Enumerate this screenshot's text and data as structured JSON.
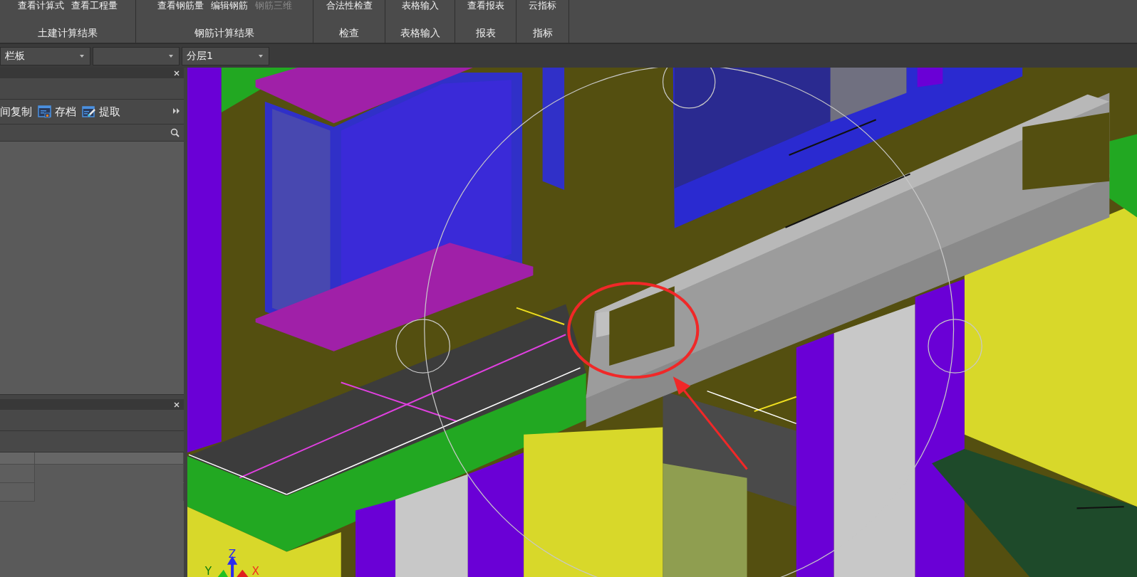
{
  "ribbon": {
    "groups": [
      {
        "label": "土建计算结果",
        "buttons": [
          {
            "label": "查看计算式",
            "disabled": false
          },
          {
            "label": "查看工程量",
            "disabled": false
          }
        ]
      },
      {
        "label": "钢筋计算结果",
        "buttons": [
          {
            "label": "查看钢筋量",
            "disabled": false
          },
          {
            "label": "编辑钢筋",
            "disabled": false
          },
          {
            "label": "钢筋三维",
            "disabled": true
          }
        ]
      },
      {
        "label": "检查",
        "buttons": [
          {
            "label": "合法性检查",
            "disabled": false
          }
        ]
      },
      {
        "label": "表格输入",
        "buttons": [
          {
            "label": "表格输入",
            "disabled": false
          }
        ]
      },
      {
        "label": "报表",
        "buttons": [
          {
            "label": "查看报表",
            "disabled": false
          }
        ]
      },
      {
        "label": "指标",
        "buttons": [
          {
            "label": "云指标",
            "disabled": false
          }
        ]
      }
    ]
  },
  "selectors": [
    {
      "kind": "filled",
      "value": "栏板"
    },
    {
      "kind": "blank"
    },
    {
      "kind": "filled",
      "value": "分层1"
    }
  ],
  "panel_top": {
    "toolbar": [
      {
        "label": "间复制",
        "kind": "text"
      },
      {
        "label": "存档",
        "kind": "save"
      },
      {
        "label": "提取",
        "kind": "extract"
      }
    ]
  },
  "axis_triad": {
    "labels": [
      {
        "label": "Z",
        "color": "#2a2af0"
      },
      {
        "label": "Y",
        "color": "#0a7a0a"
      },
      {
        "label": "X",
        "color": "#f03020"
      }
    ]
  }
}
